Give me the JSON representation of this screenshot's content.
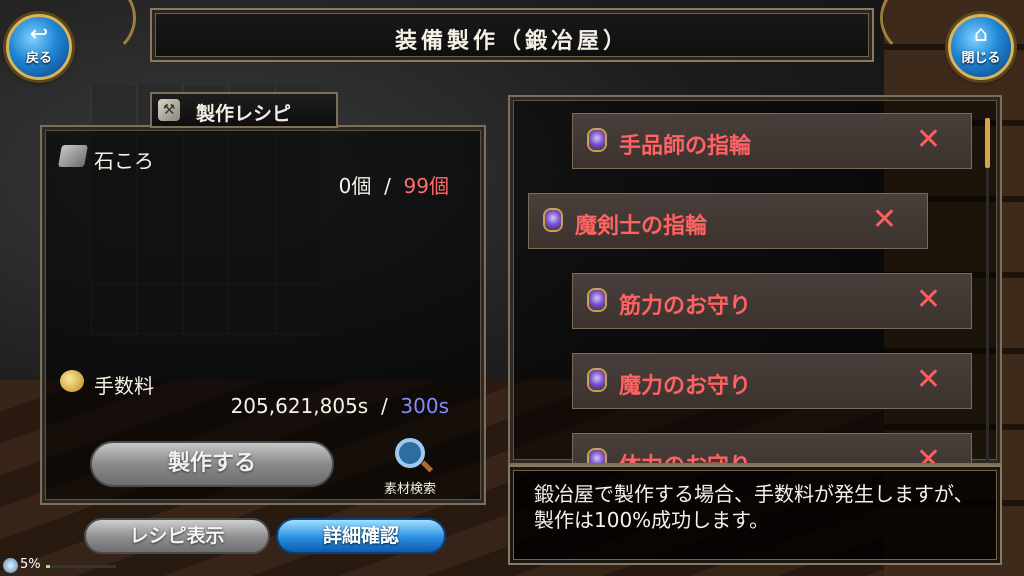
{
  "header": {
    "title": "装備製作（鍛冶屋）",
    "back_label": "戻る",
    "close_label": "閉じる"
  },
  "recipe": {
    "header_label": "製作レシピ",
    "material": {
      "name": "石ころ",
      "owned": "0個",
      "separator": "/",
      "required": "99個"
    },
    "fee": {
      "label": "手数料",
      "owned": "205,621,805s",
      "separator": "/",
      "required": "300s"
    },
    "craft_button": "製作する",
    "material_search": "素材検索"
  },
  "bottom_buttons": {
    "recipe_view": "レシピ表示",
    "detail": "詳細確認"
  },
  "status": {
    "percent": "5%",
    "progress": 0.05
  },
  "recipe_list": {
    "items": [
      {
        "name": "手品師の指輪",
        "mark": "✕"
      },
      {
        "name": "魔剣士の指輪",
        "mark": "✕"
      },
      {
        "name": "筋力のお守り",
        "mark": "✕"
      },
      {
        "name": "魔力のお守り",
        "mark": "✕"
      },
      {
        "name": "体力のお守り",
        "mark": "✕"
      }
    ]
  },
  "info_message": "鍛冶屋で製作する場合、手数料が発生しますが、製作は100%成功します。"
}
